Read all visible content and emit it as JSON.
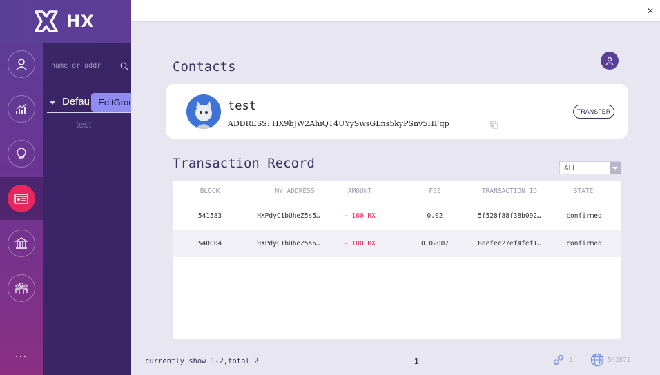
{
  "app": {
    "logo_text": "HX"
  },
  "sidebar": {
    "search_placeholder": "name or addr",
    "group_name": "Defau",
    "edit_tooltip": "EditGroup",
    "contact_item": "test",
    "more": "...",
    "nav": [
      {
        "icon": "user-icon"
      },
      {
        "icon": "chart-icon"
      },
      {
        "icon": "lightbulb-icon"
      },
      {
        "icon": "address-book-icon",
        "active": true
      },
      {
        "icon": "bank-icon"
      },
      {
        "icon": "community-icon"
      }
    ]
  },
  "window": {
    "minimize": "–",
    "close": "✕"
  },
  "main": {
    "contacts_title": "Contacts",
    "contact": {
      "name": "test",
      "address_label": "ADDRESS:",
      "address": "HX9bJW2AhiQT4UYySwsGLns5kyPSnv5HFqp",
      "transfer_label": "TRANSFER"
    },
    "tx_title": "Transaction Record",
    "filter_value": "ALL",
    "table": {
      "headers": [
        "BLOCK",
        "MY ADDRESS",
        "AMOUNT",
        "FEE",
        "TRANSACTION ID",
        "STATE"
      ],
      "rows": [
        {
          "block": "541583",
          "my_address": "HXPdyC1bUheZ5s5…",
          "amount": "- 100 HX",
          "fee": "0.02",
          "tx_id": "5f528f88f38b092…",
          "state": "confirmed"
        },
        {
          "block": "540004",
          "my_address": "HXPdyC1bUheZ5s5…",
          "amount": "- 100 HX",
          "fee": "0.02007",
          "tx_id": "8defec27ef4fef1…",
          "state": "confirmed"
        }
      ]
    },
    "status": {
      "summary": "currently show 1-2,total 2",
      "page": "1",
      "connections": "1",
      "block_height": "542871"
    }
  },
  "colors": {
    "accent": "#e8265e",
    "brand": "#5a3f98",
    "text_dark": "#3b3460"
  }
}
